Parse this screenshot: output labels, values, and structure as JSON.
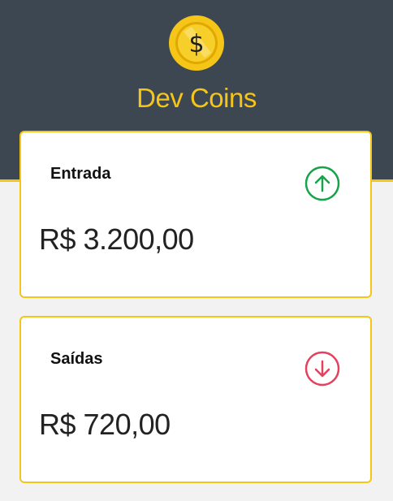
{
  "app": {
    "title": "Dev Coins",
    "logo_icon": "dollar-coin-icon"
  },
  "cards": [
    {
      "label": "Entrada",
      "value": "R$ 3.200,00",
      "icon": "arrow-up-circle-icon",
      "color": "#16a34a"
    },
    {
      "label": "Saídas",
      "value": "R$ 720,00",
      "icon": "arrow-down-circle-icon",
      "color": "#e5405e"
    }
  ],
  "colors": {
    "header_bg": "#3d4752",
    "accent": "#f5c518",
    "page_bg": "#f2f2f2"
  }
}
